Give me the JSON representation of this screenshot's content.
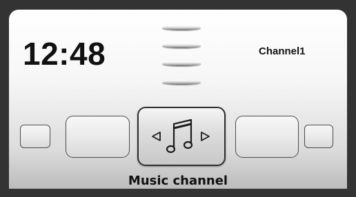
{
  "status": {
    "time": "12:48",
    "channel": "Channel1"
  },
  "carousel": {
    "selected_mode": "Music channel",
    "selected_icon": "music-note-icon",
    "other_cards": 4
  },
  "colors": {
    "frame": "#333333",
    "text": "#111111",
    "card_border": "#4a4a4a"
  }
}
